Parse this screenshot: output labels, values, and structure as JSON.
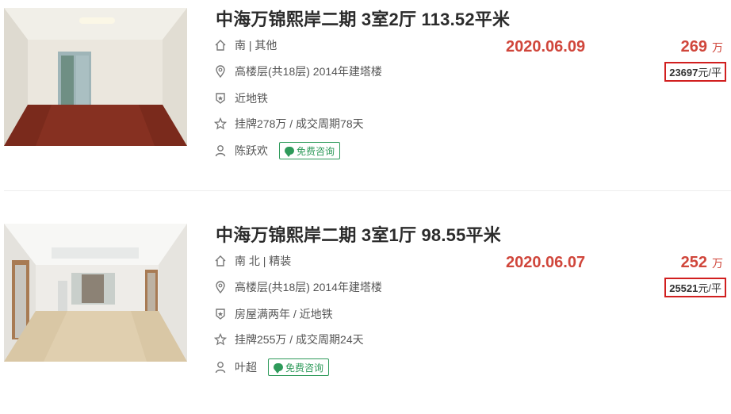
{
  "listings": [
    {
      "title": "中海万锦熙岸二期 3室2厅 113.52平米",
      "orientation": "南 | 其他",
      "floor_info": "高楼层(共18层) 2014年建塔楼",
      "tag": "近地铁",
      "listing_info": "挂牌278万 / 成交周期78天",
      "agent": "陈跃欢",
      "consult_label": "免费咨询",
      "deal_date": "2020.06.09",
      "total_price": "269",
      "price_unit": "万",
      "unit_price_value": "23697",
      "unit_price_suffix": "元/平",
      "icons": [
        "house-icon",
        "location-icon",
        "subway-shield-icon",
        "star-icon",
        "person-icon"
      ]
    },
    {
      "title": "中海万锦熙岸二期 3室1厅 98.55平米",
      "orientation": "南 北 | 精装",
      "floor_info": "高楼层(共18层) 2014年建塔楼",
      "tag": "房屋满两年 / 近地铁",
      "listing_info": "挂牌255万 / 成交周期24天",
      "agent": "叶超",
      "consult_label": "免费咨询",
      "deal_date": "2020.06.07",
      "total_price": "252",
      "price_unit": "万",
      "unit_price_value": "25521",
      "unit_price_suffix": "元/平",
      "icons": [
        "house-icon",
        "location-icon",
        "subway-shield-icon",
        "star-icon",
        "person-icon"
      ]
    }
  ],
  "colors": {
    "price_red": "#d0463b",
    "highlight_box": "#d11f1f",
    "consult_green": "#2e9a5a"
  }
}
